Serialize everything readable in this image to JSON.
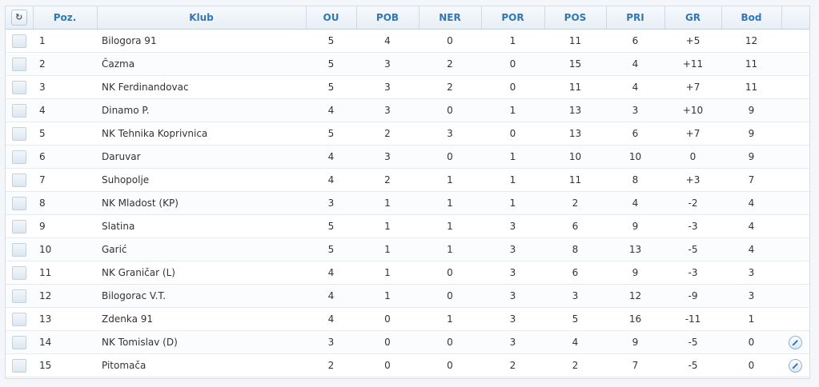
{
  "header": {
    "refresh_icon": "refresh-icon",
    "columns": [
      "Poz.",
      "Klub",
      "OU",
      "POB",
      "NER",
      "POR",
      "POS",
      "PRI",
      "GR",
      "Bod"
    ]
  },
  "rows": [
    {
      "poz": "1",
      "klub": "Bilogora 91",
      "ou": "5",
      "pob": "4",
      "ner": "0",
      "por": "1",
      "pos": "11",
      "pri": "6",
      "gr": "+5",
      "bod": "12",
      "edit": false
    },
    {
      "poz": "2",
      "klub": "Čazma",
      "ou": "5",
      "pob": "3",
      "ner": "2",
      "por": "0",
      "pos": "15",
      "pri": "4",
      "gr": "+11",
      "bod": "11",
      "edit": false
    },
    {
      "poz": "3",
      "klub": "NK Ferdinandovac",
      "ou": "5",
      "pob": "3",
      "ner": "2",
      "por": "0",
      "pos": "11",
      "pri": "4",
      "gr": "+7",
      "bod": "11",
      "edit": false
    },
    {
      "poz": "4",
      "klub": "Dinamo P.",
      "ou": "4",
      "pob": "3",
      "ner": "0",
      "por": "1",
      "pos": "13",
      "pri": "3",
      "gr": "+10",
      "bod": "9",
      "edit": false
    },
    {
      "poz": "5",
      "klub": "NK Tehnika Koprivnica",
      "ou": "5",
      "pob": "2",
      "ner": "3",
      "por": "0",
      "pos": "13",
      "pri": "6",
      "gr": "+7",
      "bod": "9",
      "edit": false
    },
    {
      "poz": "6",
      "klub": "Daruvar",
      "ou": "4",
      "pob": "3",
      "ner": "0",
      "por": "1",
      "pos": "10",
      "pri": "10",
      "gr": "0",
      "bod": "9",
      "edit": false
    },
    {
      "poz": "7",
      "klub": "Suhopolje",
      "ou": "4",
      "pob": "2",
      "ner": "1",
      "por": "1",
      "pos": "11",
      "pri": "8",
      "gr": "+3",
      "bod": "7",
      "edit": false
    },
    {
      "poz": "8",
      "klub": "NK Mladost (KP)",
      "ou": "3",
      "pob": "1",
      "ner": "1",
      "por": "1",
      "pos": "2",
      "pri": "4",
      "gr": "-2",
      "bod": "4",
      "edit": false
    },
    {
      "poz": "9",
      "klub": "Slatina",
      "ou": "5",
      "pob": "1",
      "ner": "1",
      "por": "3",
      "pos": "6",
      "pri": "9",
      "gr": "-3",
      "bod": "4",
      "edit": false
    },
    {
      "poz": "10",
      "klub": "Garić",
      "ou": "5",
      "pob": "1",
      "ner": "1",
      "por": "3",
      "pos": "8",
      "pri": "13",
      "gr": "-5",
      "bod": "4",
      "edit": false
    },
    {
      "poz": "11",
      "klub": "NK Graničar (L)",
      "ou": "4",
      "pob": "1",
      "ner": "0",
      "por": "3",
      "pos": "6",
      "pri": "9",
      "gr": "-3",
      "bod": "3",
      "edit": false
    },
    {
      "poz": "12",
      "klub": "Bilogorac V.T.",
      "ou": "4",
      "pob": "1",
      "ner": "0",
      "por": "3",
      "pos": "3",
      "pri": "12",
      "gr": "-9",
      "bod": "3",
      "edit": false
    },
    {
      "poz": "13",
      "klub": "Zdenka 91",
      "ou": "4",
      "pob": "0",
      "ner": "1",
      "por": "3",
      "pos": "5",
      "pri": "16",
      "gr": "-11",
      "bod": "1",
      "edit": false
    },
    {
      "poz": "14",
      "klub": "NK Tomislav (D)",
      "ou": "3",
      "pob": "0",
      "ner": "0",
      "por": "3",
      "pos": "4",
      "pri": "9",
      "gr": "-5",
      "bod": "0",
      "edit": true
    },
    {
      "poz": "15",
      "klub": "Pitomača",
      "ou": "2",
      "pob": "0",
      "ner": "0",
      "por": "2",
      "pos": "2",
      "pri": "7",
      "gr": "-5",
      "bod": "0",
      "edit": true
    }
  ]
}
